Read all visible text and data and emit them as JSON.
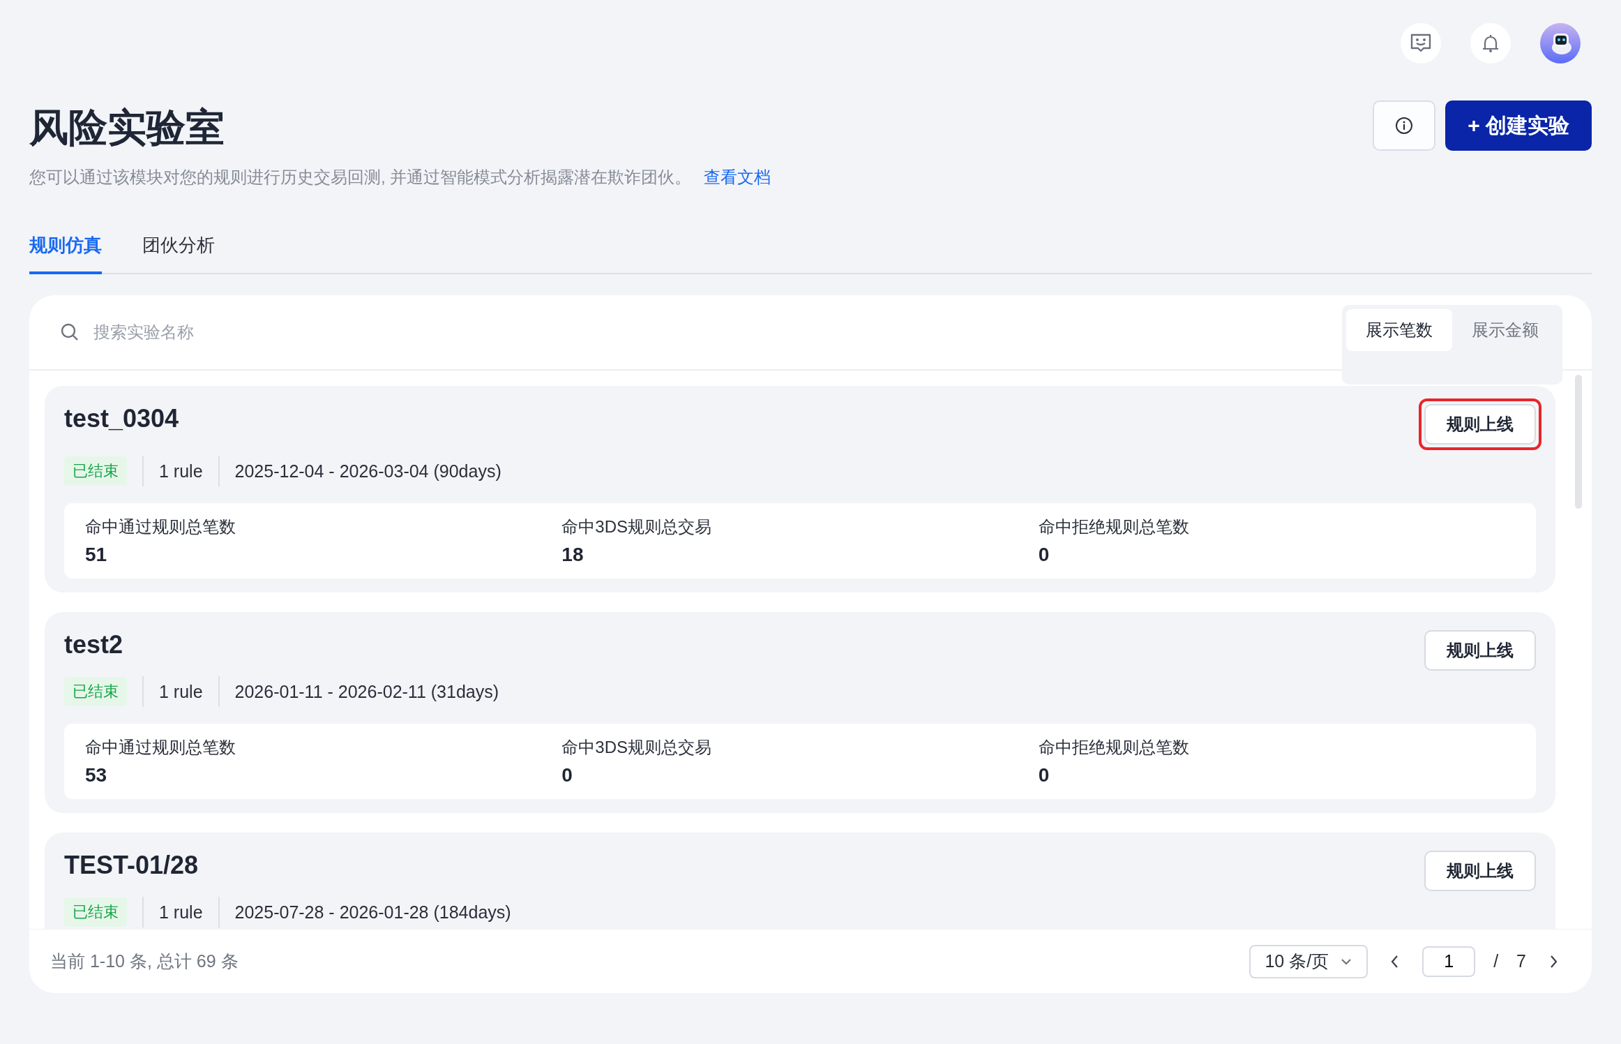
{
  "header": {
    "title": "风险实验室",
    "description": "您可以通过该模块对您的规则进行历史交易回测, 并通过智能模式分析揭露潜在欺诈团伙。",
    "doc_link": "查看文档",
    "create_button": "+ 创建实验"
  },
  "tabs": [
    {
      "label": "规则仿真",
      "selected": true
    },
    {
      "label": "团伙分析",
      "selected": false
    }
  ],
  "search": {
    "placeholder": "搜索实验名称"
  },
  "display_toggle": [
    {
      "label": "展示笔数",
      "selected": true
    },
    {
      "label": "展示金额",
      "selected": false
    }
  ],
  "experiments": [
    {
      "name": "test_0304",
      "status": "已结束",
      "rules": "1 rule",
      "period": "2025-12-04 - 2026-03-04 (90days)",
      "button": "规则上线",
      "highlighted": true,
      "stats": [
        {
          "label": "命中通过规则总笔数",
          "value": "51"
        },
        {
          "label": "命中3DS规则总交易",
          "value": "18"
        },
        {
          "label": "命中拒绝规则总笔数",
          "value": "0"
        }
      ]
    },
    {
      "name": "test2",
      "status": "已结束",
      "rules": "1 rule",
      "period": "2026-01-11 - 2026-02-11 (31days)",
      "button": "规则上线",
      "highlighted": false,
      "stats": [
        {
          "label": "命中通过规则总笔数",
          "value": "53"
        },
        {
          "label": "命中3DS规则总交易",
          "value": "0"
        },
        {
          "label": "命中拒绝规则总笔数",
          "value": "0"
        }
      ]
    },
    {
      "name": "TEST-01/28",
      "status": "已结束",
      "rules": "1 rule",
      "period": "2025-07-28 - 2026-01-28 (184days)",
      "button": "规则上线",
      "highlighted": false
    }
  ],
  "pagination": {
    "summary": "当前 1-10 条, 总计 69 条",
    "page_size": "10 条/页",
    "page": "1",
    "separator": "/",
    "total_pages": "7"
  }
}
